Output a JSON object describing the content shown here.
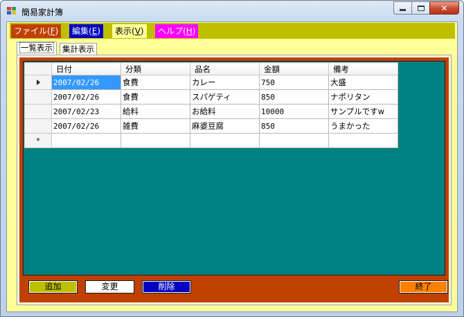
{
  "window": {
    "title": "簡易家計簿"
  },
  "menu": [
    {
      "label": "ファイル(",
      "key": "F",
      "suffix": ")",
      "bg": "#c04000",
      "color": "#ffffff"
    },
    {
      "label": "編集(",
      "key": "E",
      "suffix": ")",
      "bg": "#0000c0",
      "color": "#ffffff"
    },
    {
      "label": "表示(",
      "key": "V",
      "suffix": ")",
      "bg": "#ffff99",
      "color": "#000000"
    },
    {
      "label": "ヘルプ(",
      "key": "H",
      "suffix": ")",
      "bg": "#ff00ff",
      "color": "#ffffff"
    }
  ],
  "tabs": {
    "list": "一覧表示",
    "summary": "集計表示"
  },
  "grid": {
    "columns": [
      "日付",
      "分類",
      "品名",
      "金額",
      "備考"
    ],
    "rows": [
      [
        "2007/02/26",
        "食費",
        "カレー",
        "750",
        "大盛"
      ],
      [
        "2007/02/26",
        "食費",
        "スパゲティ",
        "850",
        "ナポリタン"
      ],
      [
        "2007/02/23",
        "給料",
        "お給料",
        "10000",
        "サンプルですw"
      ],
      [
        "2007/02/26",
        "雑費",
        "麻婆豆腐",
        "850",
        "うまかった"
      ]
    ],
    "new_row_marker": "*"
  },
  "buttons": {
    "add": "追加",
    "edit": "変更",
    "delete": "削除",
    "exit": "終了"
  },
  "colors": {
    "menubar": "#bfbf00",
    "client": "#ffff99",
    "panel": "#c04000",
    "grid_bg": "#008080",
    "selection": "#3399ff"
  }
}
